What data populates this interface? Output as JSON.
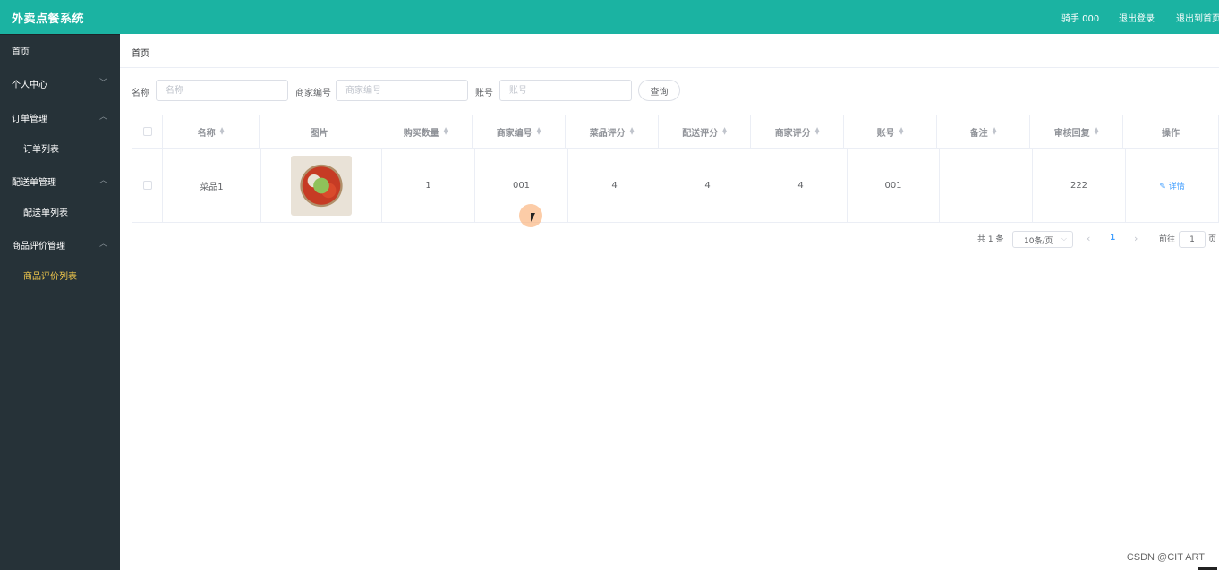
{
  "app": {
    "title": "外卖点餐系统"
  },
  "topbar": {
    "user": "骑手 000",
    "logout": "退出登录",
    "back_home": "退出到首页"
  },
  "sidebar": {
    "items": [
      {
        "label": "首页"
      },
      {
        "label": "个人中心",
        "chevron": "﹀"
      },
      {
        "label": "订单管理",
        "chevron": "︿"
      },
      {
        "label": "订单列表"
      },
      {
        "label": "配送单管理",
        "chevron": "︿"
      },
      {
        "label": "配送单列表"
      },
      {
        "label": "商品评价管理",
        "chevron": "︿"
      },
      {
        "label": "商品评价列表",
        "active": true
      }
    ]
  },
  "breadcrumb": {
    "current": "首页"
  },
  "search": {
    "name_label": "名称",
    "name_placeholder": "名称",
    "shop_label": "商家编号",
    "shop_placeholder": "商家编号",
    "account_label": "账号",
    "account_placeholder": "账号",
    "query_button": "查询"
  },
  "table": {
    "headers": [
      "名称",
      "图片",
      "购买数量",
      "商家编号",
      "菜品评分",
      "配送评分",
      "商家评分",
      "账号",
      "备注",
      "审核回复",
      "操作"
    ],
    "rows": [
      {
        "name": "菜品1",
        "image": "dish-photo",
        "quantity": "1",
        "shop_no": "001",
        "dish_score": "4",
        "delivery_score": "4",
        "shop_score": "4",
        "account": "001",
        "remark": "",
        "reply": "222",
        "action": "详情"
      }
    ],
    "action_icon": "edit-icon"
  },
  "pagination": {
    "total": "共 1 条",
    "page_size": "10条/页",
    "current_page": "1",
    "goto_label": "前往",
    "goto_value": "1",
    "page_unit": "页",
    "prev": "‹",
    "next": "›"
  },
  "watermark": "CSDN @CIT ART",
  "colors": {
    "topbar": "#1bb3a2",
    "sidebar": "#263238",
    "active_menu": "#f2c94c",
    "link": "#409eff"
  }
}
